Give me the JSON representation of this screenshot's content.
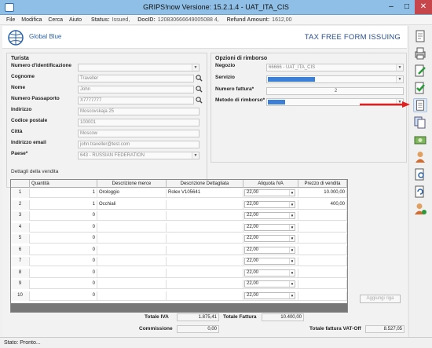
{
  "window": {
    "title": "GRIPS!now Versione: 15.2.1.4 - UAT_ITA_CIS",
    "minimize": "–",
    "maximize": "□",
    "close": "✕"
  },
  "menu": {
    "file": "File",
    "modifica": "Modifica",
    "cerca": "Cerca",
    "aiuto": "Aiuto",
    "status_label": "Status:",
    "status_value": "Issued,",
    "docid_label": "DocID:",
    "docid_value": "120830666649005088 4,",
    "refund_label": "Refund Amount:",
    "refund_value": "1612,00"
  },
  "header": {
    "logo_text": "Global Blue",
    "title": "TAX FREE FORM ISSUING"
  },
  "tourist": {
    "section": "Turista",
    "id_label": "Numero d'identificazione",
    "surname_label": "Cognome",
    "surname_value": "Traveller",
    "name_label": "Nome",
    "name_value": "John",
    "passport_label": "Numero Passaporto",
    "passport_value": "X7777777",
    "address_label": "Indirizzo",
    "address_value": "Moscovskaja 25",
    "postal_label": "Codice postale",
    "postal_value": "100001",
    "city_label": "Città",
    "city_value": "Moscow",
    "email_label": "Indirizzo email",
    "email_value": "john.traveller@test.com",
    "country_label": "Paese*",
    "country_value": "643 - RUSSIAN FEDERATION"
  },
  "refund": {
    "section": "Opzioni di rimborso",
    "shop_label": "Negozio",
    "shop_value": "66666 - UAT_ITA_CIS",
    "service_label": "Servizio",
    "service_value": "",
    "invoice_label": "Numero fattura*",
    "invoice_value": "2",
    "method_label": "Metodo di rimborso*",
    "method_value": ""
  },
  "sales": {
    "section": "Dettagli della vendita",
    "columns": [
      "Quantità",
      "Descrizione merce",
      "Descrizione Dettagliata",
      "Aliquota IVA",
      "Prezzo di vendita"
    ],
    "rows": [
      {
        "n": "1",
        "qty": "1",
        "desc": "Orologgio",
        "detail": "Rolex V105641",
        "vat": "22,00",
        "price": "10.000,00"
      },
      {
        "n": "2",
        "qty": "1",
        "desc": "Occhiali",
        "detail": "",
        "vat": "22,00",
        "price": "400,00"
      },
      {
        "n": "3",
        "qty": "0",
        "desc": "",
        "detail": "",
        "vat": "22,00",
        "price": ""
      },
      {
        "n": "4",
        "qty": "0",
        "desc": "",
        "detail": "",
        "vat": "22,00",
        "price": ""
      },
      {
        "n": "5",
        "qty": "0",
        "desc": "",
        "detail": "",
        "vat": "22,00",
        "price": ""
      },
      {
        "n": "6",
        "qty": "0",
        "desc": "",
        "detail": "",
        "vat": "22,00",
        "price": ""
      },
      {
        "n": "7",
        "qty": "0",
        "desc": "",
        "detail": "",
        "vat": "22,00",
        "price": ""
      },
      {
        "n": "8",
        "qty": "0",
        "desc": "",
        "detail": "",
        "vat": "22,00",
        "price": ""
      },
      {
        "n": "9",
        "qty": "0",
        "desc": "",
        "detail": "",
        "vat": "22,00",
        "price": ""
      },
      {
        "n": "10",
        "qty": "0",
        "desc": "",
        "detail": "",
        "vat": "22,00",
        "price": ""
      }
    ],
    "add_row": "Aggiungi riga"
  },
  "totals": {
    "vat_label": "Totale IVA",
    "vat_value": "1.875,41",
    "invoice_label": "Totale Fattura",
    "invoice_value": "10.400,00",
    "commission_label": "Commissione",
    "commission_value": "0,00",
    "vatoff_label": "Totale fattura VAT-Off",
    "vatoff_value": "8.527,05"
  },
  "status": "Stato: Pronto...",
  "colors": {
    "titlebar": "#8fbfe6",
    "brand": "#2a62a8",
    "selection": "#3b7fd6",
    "arrow": "#e02020"
  }
}
